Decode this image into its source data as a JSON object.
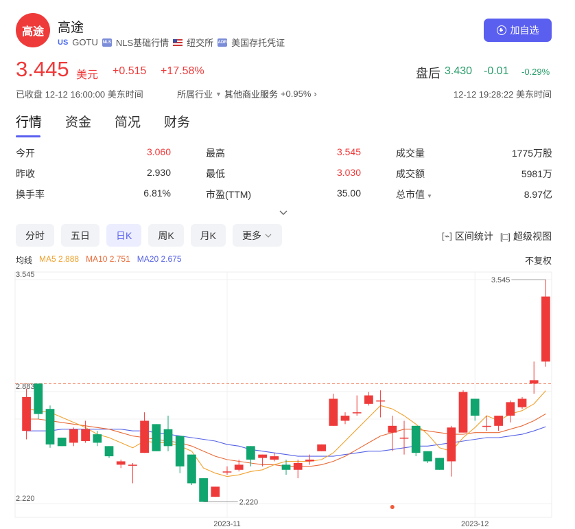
{
  "header": {
    "logo_text": "高途",
    "name": "高途",
    "market": "US",
    "ticker": "GOTU",
    "data_source": "NLS基础行情",
    "exchange": "纽交所",
    "security_type": "美国存托凭证",
    "follow_label": "加自选"
  },
  "quote": {
    "price": "3.445",
    "currency": "美元",
    "change": "+0.515",
    "change_pct": "+17.58%",
    "after_hours_label": "盘后",
    "after_hours_price": "3.430",
    "after_hours_change": "-0.01",
    "after_hours_pct": "-0.29%",
    "close_status": "已收盘 12-12 16:00:00 美东时间",
    "industry_label": "所属行业",
    "industry_name": "其他商业服务",
    "industry_change": "+0.95%",
    "after_hours_time": "12-12 19:28:22 美东时间"
  },
  "tabs": [
    "行情",
    "资金",
    "简况",
    "财务"
  ],
  "stats": [
    [
      {
        "label": "今开",
        "value": "3.060",
        "color": "red"
      },
      {
        "label": "最高",
        "value": "3.545",
        "color": "red"
      },
      {
        "label": "成交量",
        "value": "1775万股"
      }
    ],
    [
      {
        "label": "昨收",
        "value": "2.930"
      },
      {
        "label": "最低",
        "value": "3.030",
        "color": "red"
      },
      {
        "label": "成交额",
        "value": "5981万"
      }
    ],
    [
      {
        "label": "换手率",
        "value": "6.81%"
      },
      {
        "label": "市盈(TTM)",
        "value": "35.00"
      },
      {
        "label": "总市值",
        "value": "8.97亿"
      }
    ]
  ],
  "periods": [
    "分时",
    "五日",
    "日K",
    "周K",
    "月K",
    "更多"
  ],
  "active_period": "日K",
  "tools": {
    "range_stats": "区间统计",
    "super_view": "超级视图",
    "adjust": "不复权"
  },
  "ma": {
    "title": "均线",
    "ma5": "MA5 2.888",
    "ma10": "MA10 2.751",
    "ma20": "MA20 2.675"
  },
  "colors": {
    "up": "#ef3a3a",
    "down": "#10a56e",
    "accent": "#5a5ff0",
    "ma5": "#f0a22e",
    "ma10": "#e86a37",
    "ma20": "#5562e6"
  },
  "chart_data": {
    "type": "candlestick",
    "y_ticks": [
      "3.545",
      "2.883",
      "2.220"
    ],
    "ylim": [
      2.22,
      3.545
    ],
    "x_ticks": [
      {
        "label": "2023-11",
        "index": 17
      },
      {
        "label": "2023-12",
        "index": 38
      }
    ],
    "max_label": "3.545",
    "min_label": "2.220",
    "reference_price": 2.93,
    "candles": [
      {
        "o": 2.65,
        "h": 2.9,
        "l": 2.6,
        "c": 2.85
      },
      {
        "o": 2.93,
        "h": 2.93,
        "l": 2.72,
        "c": 2.75
      },
      {
        "o": 2.78,
        "h": 2.8,
        "l": 2.55,
        "c": 2.57
      },
      {
        "o": 2.61,
        "h": 2.61,
        "l": 2.56,
        "c": 2.56
      },
      {
        "o": 2.58,
        "h": 2.67,
        "l": 2.56,
        "c": 2.66
      },
      {
        "o": 2.59,
        "h": 2.71,
        "l": 2.58,
        "c": 2.66
      },
      {
        "o": 2.63,
        "h": 2.65,
        "l": 2.56,
        "c": 2.58
      },
      {
        "o": 2.56,
        "h": 2.56,
        "l": 2.49,
        "c": 2.5
      },
      {
        "o": 2.45,
        "h": 2.48,
        "l": 2.43,
        "c": 2.47
      },
      {
        "o": 2.45,
        "h": 2.46,
        "l": 2.34,
        "c": 2.45
      },
      {
        "o": 2.52,
        "h": 2.76,
        "l": 2.52,
        "c": 2.71
      },
      {
        "o": 2.69,
        "h": 2.69,
        "l": 2.53,
        "c": 2.53
      },
      {
        "o": 2.66,
        "h": 2.74,
        "l": 2.53,
        "c": 2.56
      },
      {
        "o": 2.62,
        "h": 2.62,
        "l": 2.4,
        "c": 2.44
      },
      {
        "o": 2.51,
        "h": 2.51,
        "l": 2.33,
        "c": 2.34
      },
      {
        "o": 2.37,
        "h": 2.37,
        "l": 2.23,
        "c": 2.23
      },
      {
        "o": 2.26,
        "h": 2.32,
        "l": 2.26,
        "c": 2.32
      },
      {
        "o": 2.41,
        "h": 2.44,
        "l": 2.39,
        "c": 2.41
      },
      {
        "o": 2.42,
        "h": 2.48,
        "l": 2.41,
        "c": 2.45
      },
      {
        "o": 2.56,
        "h": 2.56,
        "l": 2.44,
        "c": 2.48
      },
      {
        "o": 2.49,
        "h": 2.51,
        "l": 2.44,
        "c": 2.51
      },
      {
        "o": 2.48,
        "h": 2.52,
        "l": 2.47,
        "c": 2.5
      },
      {
        "o": 2.45,
        "h": 2.48,
        "l": 2.39,
        "c": 2.42
      },
      {
        "o": 2.42,
        "h": 2.48,
        "l": 2.37,
        "c": 2.46
      },
      {
        "o": 2.47,
        "h": 2.51,
        "l": 2.45,
        "c": 2.48
      },
      {
        "o": 2.53,
        "h": 2.57,
        "l": 2.53,
        "c": 2.57
      },
      {
        "o": 2.68,
        "h": 2.87,
        "l": 2.68,
        "c": 2.84
      },
      {
        "o": 2.71,
        "h": 2.76,
        "l": 2.69,
        "c": 2.74
      },
      {
        "o": 2.76,
        "h": 2.86,
        "l": 2.74,
        "c": 2.76
      },
      {
        "o": 2.81,
        "h": 2.88,
        "l": 2.8,
        "c": 2.86
      },
      {
        "o": 2.83,
        "h": 2.89,
        "l": 2.73,
        "c": 2.83
      },
      {
        "o": 2.64,
        "h": 2.74,
        "l": 2.53,
        "c": 2.68
      },
      {
        "o": 2.61,
        "h": 2.71,
        "l": 2.51,
        "c": 2.61
      },
      {
        "o": 2.68,
        "h": 2.68,
        "l": 2.5,
        "c": 2.52
      },
      {
        "o": 2.53,
        "h": 2.53,
        "l": 2.46,
        "c": 2.47
      },
      {
        "o": 2.49,
        "h": 2.49,
        "l": 2.42,
        "c": 2.42
      },
      {
        "o": 2.47,
        "h": 2.68,
        "l": 2.38,
        "c": 2.67
      },
      {
        "o": 2.64,
        "h": 2.89,
        "l": 2.64,
        "c": 2.88
      },
      {
        "o": 2.84,
        "h": 2.84,
        "l": 2.71,
        "c": 2.74
      },
      {
        "o": 2.68,
        "h": 2.74,
        "l": 2.65,
        "c": 2.68
      },
      {
        "o": 2.68,
        "h": 2.73,
        "l": 2.65,
        "c": 2.74
      },
      {
        "o": 2.74,
        "h": 2.83,
        "l": 2.7,
        "c": 2.82
      },
      {
        "o": 2.79,
        "h": 2.85,
        "l": 2.78,
        "c": 2.84
      },
      {
        "o": 2.93,
        "h": 3.06,
        "l": 2.87,
        "c": 2.95
      },
      {
        "o": 3.06,
        "h": 3.545,
        "l": 3.03,
        "c": 3.445
      }
    ],
    "ma5": [
      2.78,
      2.77,
      2.76,
      2.73,
      2.7,
      2.67,
      2.63,
      2.61,
      2.58,
      2.55,
      2.59,
      2.58,
      2.58,
      2.56,
      2.53,
      2.43,
      2.4,
      2.38,
      2.39,
      2.41,
      2.42,
      2.45,
      2.47,
      2.47,
      2.47,
      2.48,
      2.52,
      2.59,
      2.66,
      2.73,
      2.8,
      2.78,
      2.74,
      2.69,
      2.63,
      2.55,
      2.53,
      2.61,
      2.67,
      2.74,
      2.71,
      2.75,
      2.77,
      2.81,
      2.888
    ],
    "ma10": [
      2.72,
      2.72,
      2.71,
      2.7,
      2.69,
      2.68,
      2.67,
      2.66,
      2.64,
      2.62,
      2.61,
      2.6,
      2.59,
      2.58,
      2.56,
      2.53,
      2.5,
      2.48,
      2.47,
      2.46,
      2.45,
      2.45,
      2.44,
      2.44,
      2.44,
      2.45,
      2.47,
      2.5,
      2.54,
      2.58,
      2.62,
      2.64,
      2.66,
      2.66,
      2.65,
      2.64,
      2.63,
      2.63,
      2.64,
      2.64,
      2.64,
      2.66,
      2.68,
      2.71,
      2.751
    ],
    "ma20": [
      2.65,
      2.65,
      2.65,
      2.66,
      2.66,
      2.66,
      2.66,
      2.66,
      2.66,
      2.65,
      2.65,
      2.64,
      2.63,
      2.62,
      2.61,
      2.6,
      2.59,
      2.57,
      2.56,
      2.54,
      2.53,
      2.52,
      2.51,
      2.5,
      2.5,
      2.5,
      2.5,
      2.51,
      2.52,
      2.53,
      2.53,
      2.54,
      2.55,
      2.56,
      2.56,
      2.57,
      2.58,
      2.59,
      2.6,
      2.61,
      2.61,
      2.62,
      2.63,
      2.65,
      2.675
    ]
  }
}
